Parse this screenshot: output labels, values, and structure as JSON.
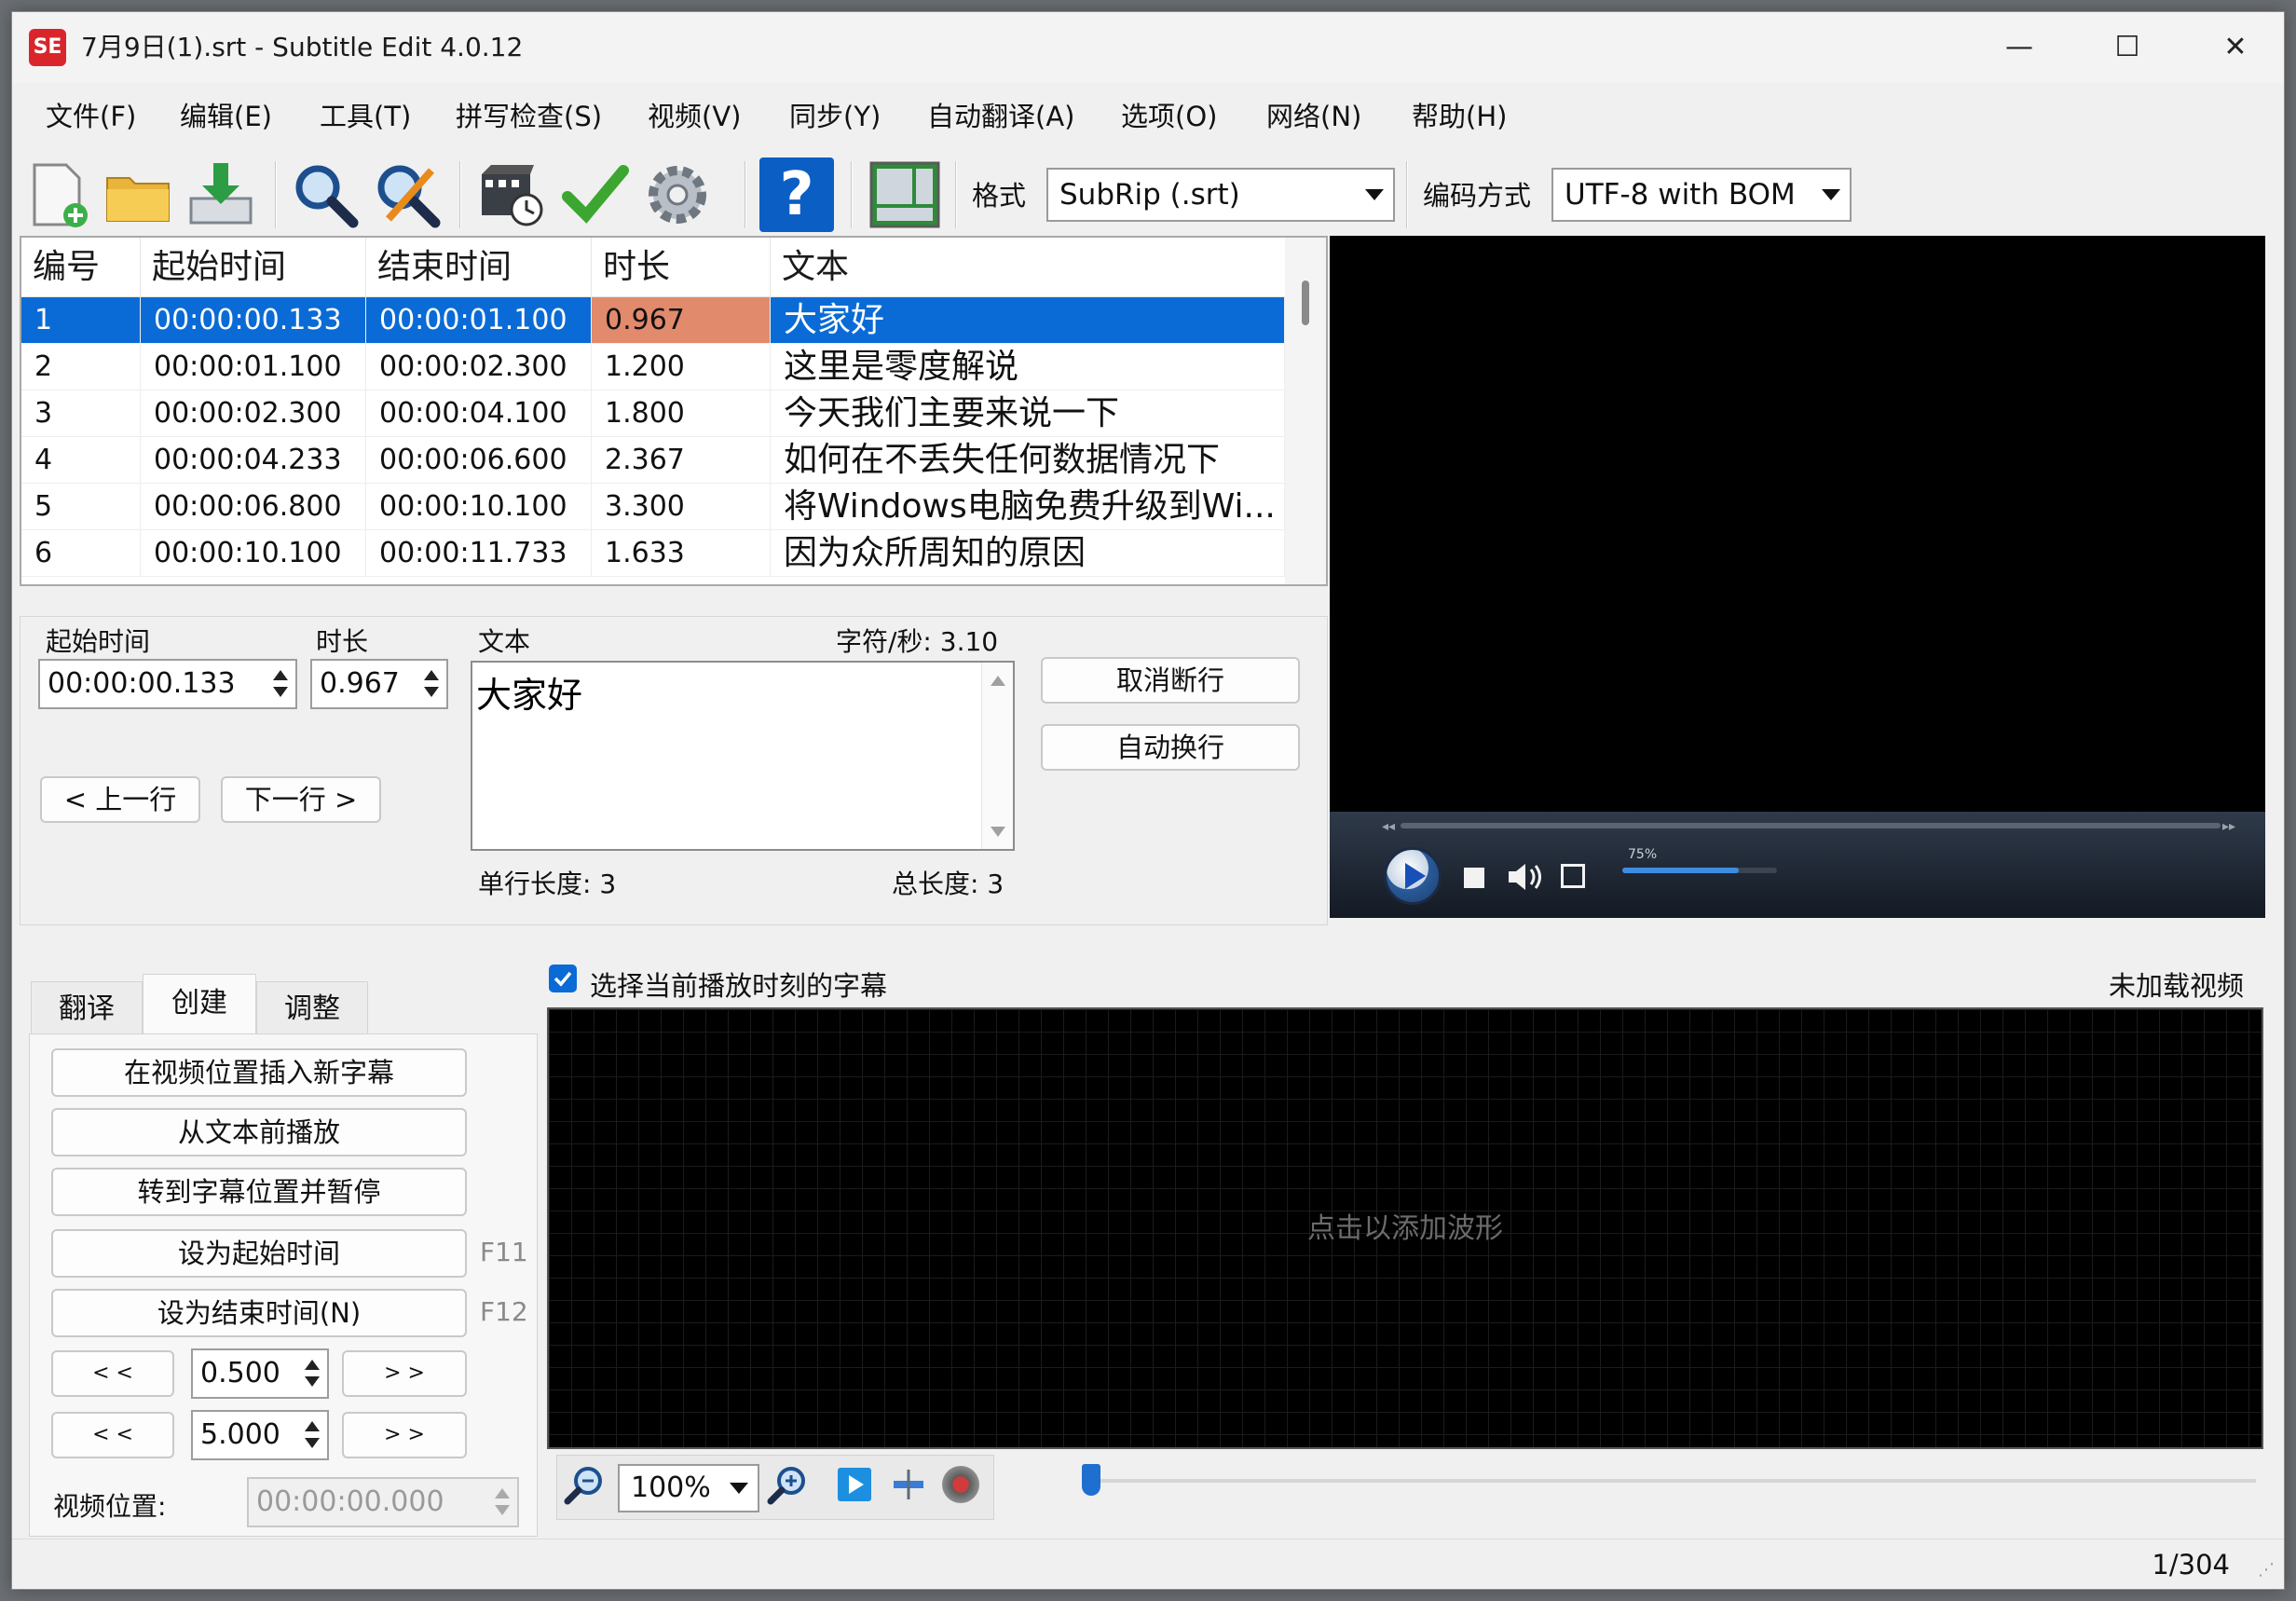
{
  "window": {
    "app_icon": "SE",
    "title": "7月9日(1).srt - Subtitle Edit 4.0.12",
    "minimize": "—",
    "maximize": "☐",
    "close": "✕"
  },
  "menu": [
    "文件(F)",
    "编辑(E)",
    "工具(T)",
    "拼写检查(S)",
    "视频(V)",
    "同步(Y)",
    "自动翻译(A)",
    "选项(O)",
    "网络(N)",
    "帮助(H)"
  ],
  "toolbar": {
    "icons": [
      "new-file-icon",
      "open-folder-icon",
      "save-download-icon",
      "find-icon",
      "replace-icon",
      "video-sync-icon",
      "check-icon",
      "settings-gear-icon",
      "help-icon",
      "layout-icon"
    ],
    "help_glyph": "?",
    "format_label": "格式",
    "format_value": "SubRip (.srt)",
    "encoding_label": "编码方式",
    "encoding_value": "UTF-8 with BOM"
  },
  "grid": {
    "headers": [
      "编号",
      "起始时间",
      "结束时间",
      "时长",
      "文本"
    ],
    "rows": [
      {
        "num": "1",
        "start": "00:00:00.133",
        "end": "00:00:01.100",
        "dur": "0.967",
        "text": "大家好"
      },
      {
        "num": "2",
        "start": "00:00:01.100",
        "end": "00:00:02.300",
        "dur": "1.200",
        "text": "这里是零度解说"
      },
      {
        "num": "3",
        "start": "00:00:02.300",
        "end": "00:00:04.100",
        "dur": "1.800",
        "text": "今天我们主要来说一下"
      },
      {
        "num": "4",
        "start": "00:00:04.233",
        "end": "00:00:06.600",
        "dur": "2.367",
        "text": "如何在不丢失任何数据情况下"
      },
      {
        "num": "5",
        "start": "00:00:06.800",
        "end": "00:00:10.100",
        "dur": "3.300",
        "text": "将Windows电脑免费升级到Wi..."
      },
      {
        "num": "6",
        "start": "00:00:10.100",
        "end": "00:00:11.733",
        "dur": "1.633",
        "text": "因为众所周知的原因"
      }
    ]
  },
  "edit": {
    "start_label": "起始时间",
    "start_value": "00:00:00.133",
    "dur_label": "时长",
    "dur_value": "0.967",
    "text_label": "文本",
    "cps": "字符/秒: 3.10",
    "text_value": "大家好",
    "prev_btn": "< 上一行",
    "next_btn": "下一行 >",
    "unbreak_btn": "取消断行",
    "autobreak_btn": "自动换行",
    "single_len": "单行长度: 3",
    "total_len": "总长度: 3"
  },
  "video": {
    "volume_label": "75%"
  },
  "tabs": [
    "翻译",
    "创建",
    "调整"
  ],
  "create": {
    "insert_btn": "在视频位置插入新字幕",
    "play_from_btn": "从文本前播放",
    "goto_pause_btn": "转到字幕位置并暂停",
    "set_start_btn": "设为起始时间",
    "set_start_key": "F11",
    "set_end_btn": "设为结束时间(N)",
    "set_end_key": "F12",
    "back_label": "< <",
    "fwd_label": "> >",
    "step1": "0.500",
    "step2": "5.000",
    "video_pos_label": "视频位置:",
    "video_pos_value": "00:00:00.000"
  },
  "waveform": {
    "checkbox_label": "选择当前播放时刻的字幕",
    "checked": true,
    "no_video": "未加载视频",
    "hint": "点击以添加波形",
    "zoom": "100%"
  },
  "status": {
    "position": "1/304"
  },
  "colors": {
    "selection": "#0a6bd6",
    "duration_highlight": "#e28a6c",
    "checkbox": "#0a6bd6"
  }
}
